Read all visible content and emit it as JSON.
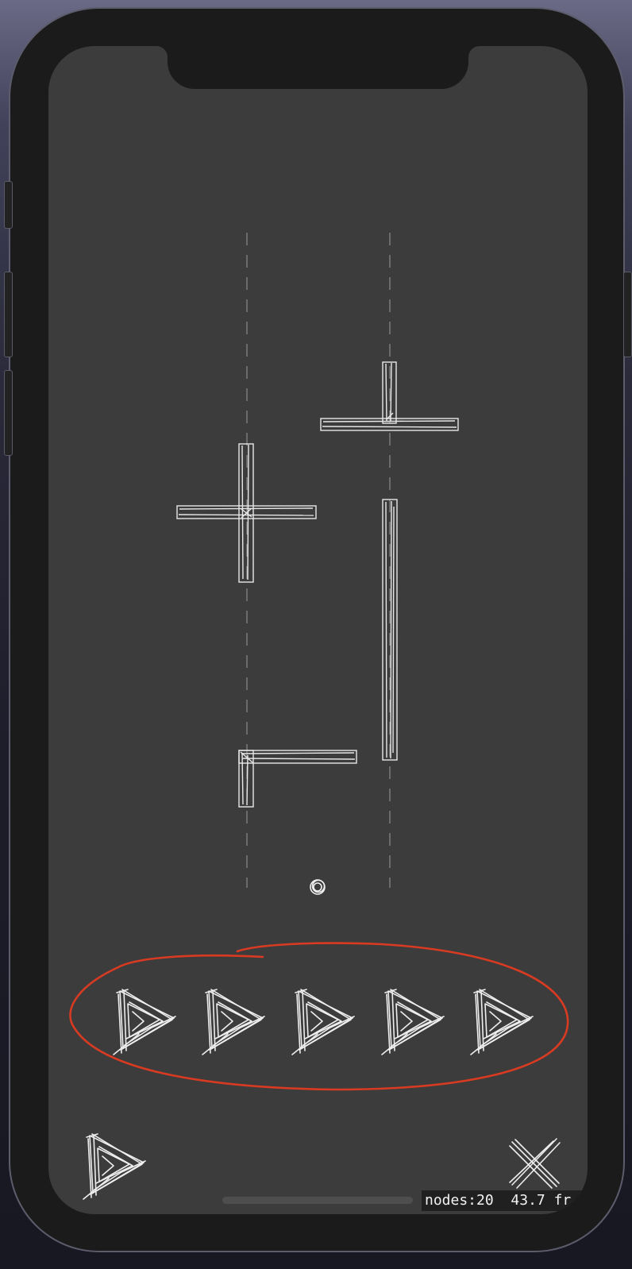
{
  "hud": {
    "nodes_label": "nodes:20",
    "fps_label": "43.7 fr"
  },
  "level": {
    "pieces": [
      "t-piece",
      "cross-piece",
      "i-piece",
      "l-piece"
    ],
    "ball": "ball"
  },
  "tray": {
    "launcher_count": 5,
    "highlight": "red-circle-annotation"
  },
  "controls": {
    "left": "play-icon",
    "right": "close-icon"
  },
  "colors": {
    "screen": "#3c3c3c",
    "frame": "#1b1b1b",
    "stroke": "#e8e8e8",
    "annotation": "#d93a22",
    "guide": "#8a8a8a"
  }
}
